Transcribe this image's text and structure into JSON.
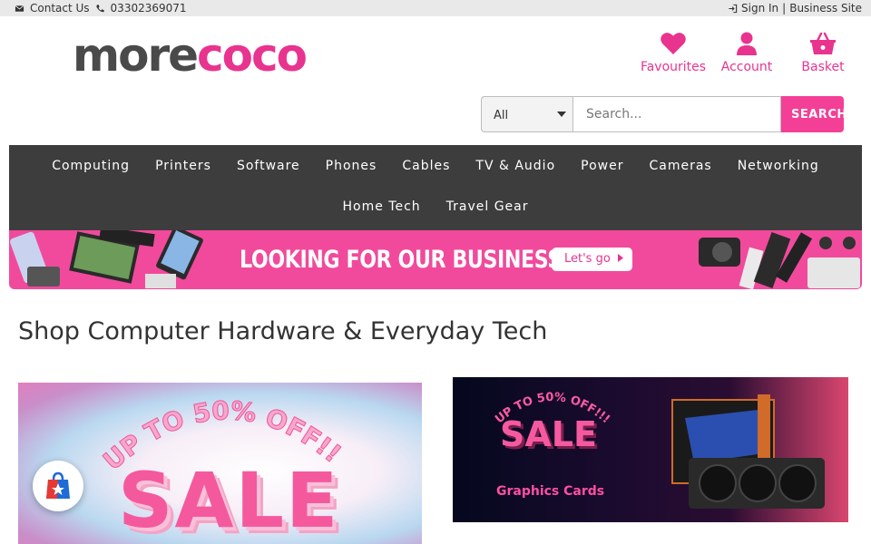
{
  "topbar": {
    "contact_label": "Contact Us",
    "phone": "03302369071",
    "signin_label": "Sign In",
    "separator": "|",
    "business_label": "Business Site"
  },
  "logo": {
    "part1": "more",
    "part2": "coco"
  },
  "header_links": {
    "favourites": "Favourites",
    "account": "Account",
    "basket": "Basket"
  },
  "search": {
    "category_selected": "All",
    "placeholder": "Search...",
    "button_label": "SEARCH"
  },
  "nav": {
    "row1": [
      "Computing",
      "Printers",
      "Software",
      "Phones",
      "Cables",
      "TV & Audio",
      "Power",
      "Cameras",
      "Networking"
    ],
    "row2": [
      "Home Tech",
      "Travel Gear"
    ]
  },
  "business_banner": {
    "headline": "LOOKING FOR OUR BUSINESS SITE?",
    "cta": "Let's go"
  },
  "page_title": "Shop Computer Hardware & Everyday Tech",
  "promo1": {
    "upto": "UP TO 50% OFF!!!",
    "sale": "SALE"
  },
  "promo2": {
    "upto": "UP TO 50% OFF!!!",
    "sale": "SALE",
    "subtitle": "Graphics Cards"
  },
  "colors": {
    "brand_pink": "#e8348f",
    "nav_bg": "#3d3d3d",
    "search_button": "#f43f97"
  },
  "icons": {
    "contact": "envelope-icon",
    "phone": "phone-icon",
    "signin": "sign-in-icon",
    "favourites": "heart-icon",
    "account": "user-icon",
    "basket": "basket-icon",
    "fab": "shopping-bag-icon"
  }
}
